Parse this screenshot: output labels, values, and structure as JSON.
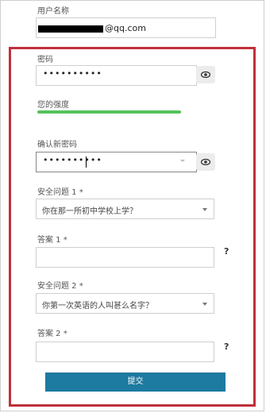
{
  "fields": {
    "username_label": "用户名称",
    "email_suffix": "@qq.com",
    "password_label": "密码",
    "password_value": "••••••••••",
    "strength_label": "您的强度",
    "confirm_label": "确认新密码",
    "confirm_value": "••••••••••",
    "q1_label": "安全问题 1 *",
    "q1_value": "你在那一所初中学校上学？",
    "a1_label": "答案 1 *",
    "q2_label": "安全问题 2 *",
    "q2_value": "你第一次英语的人叫甚么名字？",
    "a2_label": "答案 2 *",
    "help_mark": "?",
    "submit_label": "提交"
  },
  "indicators": {
    "password_strength_fraction": 1.0,
    "strength_color": "#55c25a"
  },
  "icons": [
    "eye-icon",
    "chevron-down-icon"
  ],
  "colors": {
    "highlight_border": "#c0303a",
    "submit_bg": "#1d7aa0"
  }
}
